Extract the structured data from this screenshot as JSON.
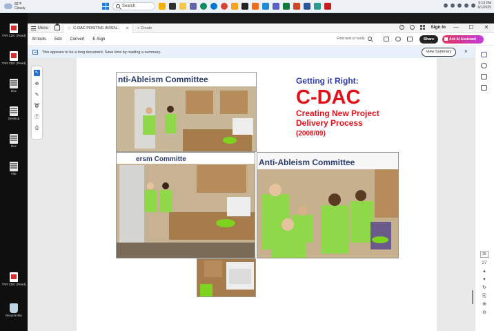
{
  "taskbar": {
    "weather_temp": "82°F",
    "weather_desc": "Cloudy",
    "search_placeholder": "Search",
    "clock_time": "5:13 PM",
    "clock_date": "6/1/2025"
  },
  "desktop": {
    "icons": [
      {
        "label": "TAR CDC (Read)",
        "type": "pdf"
      },
      {
        "label": "TAR CDC (Read)",
        "type": "pdf"
      },
      {
        "label": "Doc",
        "type": "doc"
      },
      {
        "label": "Desktop",
        "type": "doc"
      },
      {
        "label": "Doc",
        "type": "doc"
      },
      {
        "label": "File",
        "type": "doc"
      },
      {
        "label": "TAR CDC (Read)",
        "type": "pdf"
      },
      {
        "label": "Recycle Bin",
        "type": "bin"
      }
    ]
  },
  "tabs": {
    "menu_label": "Menu",
    "doc_tab_label": "C-DAC POSITIVE INVEN...",
    "new_tab_label": "Create",
    "sign_in": "Sign In"
  },
  "toolbar": {
    "menus": [
      "All tools",
      "Edit",
      "Convert",
      "E-Sign"
    ],
    "find_placeholder": "Find text or tools",
    "share": "Share",
    "ai_assistant": "Ask AI Assistant"
  },
  "banner": {
    "text": "This appears to be a long document. Save time by reading a summary.",
    "button": "View Summary"
  },
  "rail": {
    "page_number": "25",
    "page_total": "27"
  },
  "slide": {
    "subtitle": "Getting it Right:",
    "title": "C-DAC",
    "line1": "Creating New Project",
    "line2": "Delivery Process",
    "year": "(2008/09)",
    "photo_banner": "nti-Ableism Committee",
    "photo_banner2": "ersm Committe",
    "photo_banner3": "Anti-Ableism Committee"
  },
  "colors": {
    "title_red": "#e3101a",
    "subtitle_blue": "#2f3aa8",
    "shirt_green": "#8fd84a"
  }
}
